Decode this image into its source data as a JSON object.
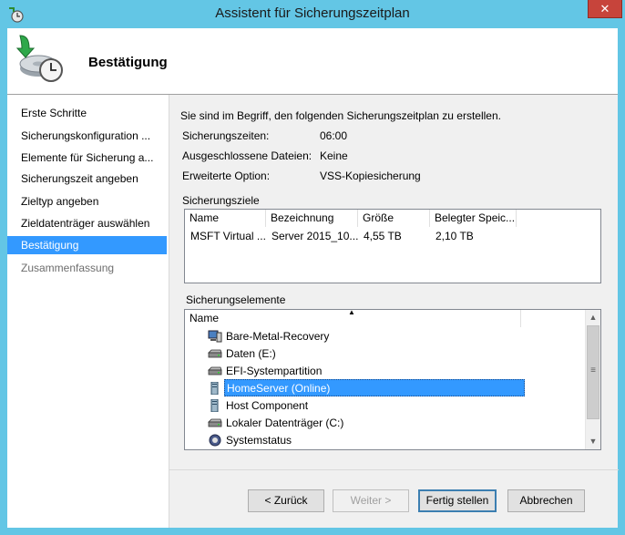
{
  "window": {
    "title": "Assistent für Sicherungszeitplan",
    "close_glyph": "✕"
  },
  "header": {
    "title": "Bestätigung",
    "icon": "backup-clock-icon"
  },
  "sidebar": {
    "items": [
      {
        "label": "Erste Schritte",
        "state": "normal"
      },
      {
        "label": "Sicherungskonfiguration ...",
        "state": "normal"
      },
      {
        "label": "Elemente für Sicherung a...",
        "state": "normal"
      },
      {
        "label": "Sicherungszeit angeben",
        "state": "normal"
      },
      {
        "label": "Zieltyp angeben",
        "state": "normal"
      },
      {
        "label": "Zieldatenträger auswählen",
        "state": "normal"
      },
      {
        "label": "Bestätigung",
        "state": "selected"
      },
      {
        "label": "Zusammenfassung",
        "state": "disabled"
      }
    ]
  },
  "main": {
    "intro": "Sie sind im Begriff, den folgenden Sicherungszeitplan zu erstellen.",
    "properties": [
      {
        "label": "Sicherungszeiten:",
        "value": "06:00"
      },
      {
        "label": "Ausgeschlossene Dateien:",
        "value": "Keine"
      },
      {
        "label": "Erweiterte Option:",
        "value": "VSS-Kopiesicherung"
      }
    ],
    "targets": {
      "heading": "Sicherungsziele",
      "columns": [
        "Name",
        "Bezeichnung",
        "Größe",
        "Belegter Speic..."
      ],
      "rows": [
        [
          "MSFT Virtual ...",
          "Server 2015_10...",
          "4,55 TB",
          "2,10 TB"
        ]
      ]
    },
    "elements": {
      "heading": "Sicherungselemente",
      "column": "Name",
      "sort_glyph": "▲",
      "items": [
        {
          "label": "Bare-Metal-Recovery",
          "icon": "computer-icon",
          "selected": false
        },
        {
          "label": "Daten (E:)",
          "icon": "drive-icon",
          "selected": false
        },
        {
          "label": "EFI-Systempartition",
          "icon": "drive-icon",
          "selected": false
        },
        {
          "label": "HomeServer (Online)",
          "icon": "server-icon",
          "selected": true
        },
        {
          "label": "Host Component",
          "icon": "server-icon",
          "selected": false
        },
        {
          "label": "Lokaler Datenträger (C:)",
          "icon": "drive-icon",
          "selected": false
        },
        {
          "label": "Systemstatus",
          "icon": "gear-icon",
          "selected": false
        }
      ],
      "scroll_up_glyph": "▲",
      "scroll_down_glyph": "▼",
      "grip_glyph": "≡"
    }
  },
  "buttons": {
    "back": "< Zurück",
    "next": "Weiter >",
    "finish": "Fertig stellen",
    "cancel": "Abbrechen"
  }
}
